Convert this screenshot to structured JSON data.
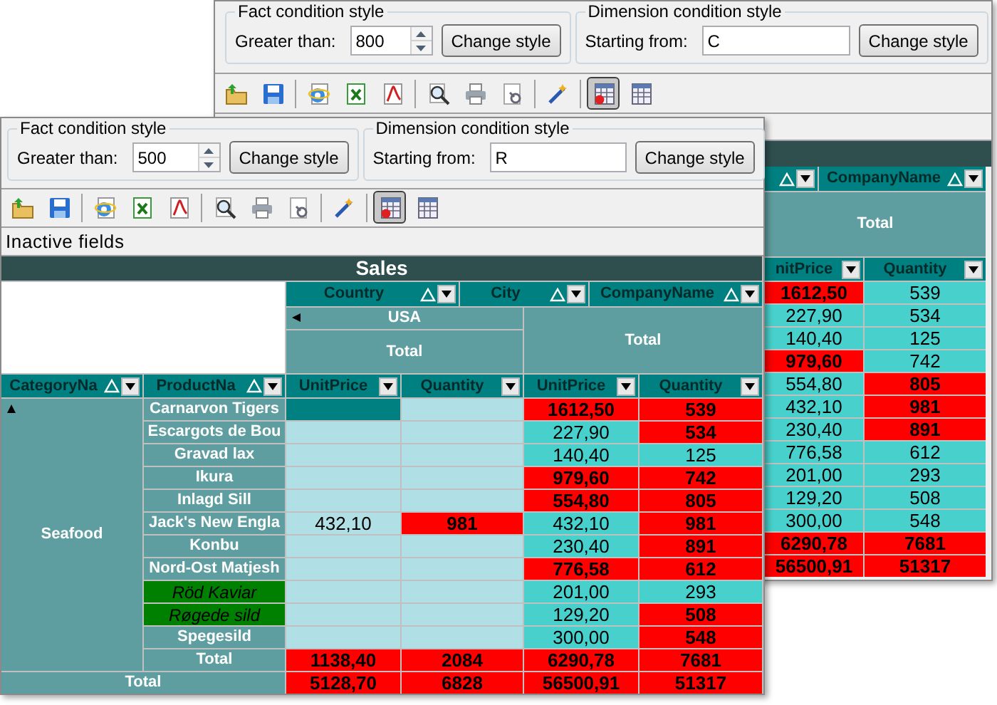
{
  "back_window": {
    "fact_condition": {
      "title": "Fact condition style",
      "label": "Greater than:",
      "value": "800",
      "button": "Change style"
    },
    "dimension_condition": {
      "title": "Dimension condition style",
      "label": "Starting from:",
      "value": "C",
      "button": "Change style"
    },
    "toolbar": [
      {
        "kind": "button",
        "pressed": false
      },
      {
        "kind": "button",
        "pressed": false
      },
      {
        "kind": "separator"
      },
      {
        "kind": "button",
        "pressed": false
      },
      {
        "kind": "button",
        "pressed": false
      },
      {
        "kind": "button",
        "pressed": false
      },
      {
        "kind": "separator"
      },
      {
        "kind": "button",
        "pressed": false
      },
      {
        "kind": "button",
        "pressed": false
      },
      {
        "kind": "button",
        "pressed": false
      },
      {
        "kind": "separator"
      },
      {
        "kind": "button",
        "pressed": false
      },
      {
        "kind": "separator"
      },
      {
        "kind": "button",
        "pressed": true
      },
      {
        "kind": "button",
        "pressed": false
      }
    ],
    "grid": {
      "column_fields": [
        {
          "sort_ascending": true
        },
        {
          "label": "CompanyName",
          "sort_ascending": true
        }
      ],
      "column_total": "Total",
      "measures": [
        {
          "label": "nitPrice"
        },
        {
          "label": "Quantity"
        }
      ],
      "rows": [
        {
          "cells": [
            {
              "value": "1612,50",
              "kind": "hot"
            },
            {
              "value": "539",
              "kind": "normal"
            }
          ]
        },
        {
          "cells": [
            {
              "value": "227,90",
              "kind": "normal"
            },
            {
              "value": "534",
              "kind": "normal"
            }
          ]
        },
        {
          "cells": [
            {
              "value": "140,40",
              "kind": "normal"
            },
            {
              "value": "125",
              "kind": "normal"
            }
          ]
        },
        {
          "cells": [
            {
              "value": "979,60",
              "kind": "hot"
            },
            {
              "value": "742",
              "kind": "normal"
            }
          ]
        },
        {
          "cells": [
            {
              "value": "554,80",
              "kind": "normal"
            },
            {
              "value": "805",
              "kind": "hot"
            }
          ]
        },
        {
          "cells": [
            {
              "value": "432,10",
              "kind": "normal"
            },
            {
              "value": "981",
              "kind": "hot"
            }
          ]
        },
        {
          "cells": [
            {
              "value": "230,40",
              "kind": "normal"
            },
            {
              "value": "891",
              "kind": "hot"
            }
          ]
        },
        {
          "cells": [
            {
              "value": "776,58",
              "kind": "normal"
            },
            {
              "value": "612",
              "kind": "normal"
            }
          ]
        },
        {
          "cells": [
            {
              "value": "201,00",
              "kind": "normal"
            },
            {
              "value": "293",
              "kind": "normal"
            }
          ]
        },
        {
          "cells": [
            {
              "value": "129,20",
              "kind": "normal"
            },
            {
              "value": "508",
              "kind": "normal"
            }
          ]
        },
        {
          "cells": [
            {
              "value": "300,00",
              "kind": "normal"
            },
            {
              "value": "548",
              "kind": "normal"
            }
          ]
        },
        {
          "cells": [
            {
              "value": "6290,78",
              "kind": "hot"
            },
            {
              "value": "7681",
              "kind": "hot"
            }
          ]
        },
        {
          "cells": [
            {
              "value": "56500,91",
              "kind": "hot"
            },
            {
              "value": "51317",
              "kind": "hot"
            }
          ]
        }
      ]
    }
  },
  "front_window": {
    "fact_condition": {
      "title": "Fact condition style",
      "label": "Greater than:",
      "value": "500",
      "button": "Change style"
    },
    "dimension_condition": {
      "title": "Dimension condition style",
      "label": "Starting from:",
      "value": "R",
      "button": "Change style"
    },
    "toolbar": [
      {
        "kind": "button",
        "pressed": false
      },
      {
        "kind": "button",
        "pressed": false
      },
      {
        "kind": "separator"
      },
      {
        "kind": "button",
        "pressed": false
      },
      {
        "kind": "button",
        "pressed": false
      },
      {
        "kind": "button",
        "pressed": false
      },
      {
        "kind": "separator"
      },
      {
        "kind": "button",
        "pressed": false
      },
      {
        "kind": "button",
        "pressed": false
      },
      {
        "kind": "button",
        "pressed": false
      },
      {
        "kind": "separator"
      },
      {
        "kind": "button",
        "pressed": false
      },
      {
        "kind": "separator"
      },
      {
        "kind": "button",
        "pressed": true
      },
      {
        "kind": "button",
        "pressed": false
      }
    ],
    "inactive_fields": "Inactive fields",
    "grid": {
      "title": "Sales",
      "column_fields": [
        {
          "label": "Country",
          "sort_ascending": true
        },
        {
          "label": "City",
          "sort_ascending": true
        },
        {
          "label": "CompanyName",
          "sort_ascending": true
        }
      ],
      "column_member": {
        "label": "USA",
        "expanded": true
      },
      "column_member_total": "Total",
      "column_total": "Total",
      "row_fields": [
        {
          "label": "CategoryNa",
          "sort_ascending": true
        },
        {
          "label": "ProductNa",
          "sort_ascending": true
        }
      ],
      "measures": [
        {
          "label": "UnitPrice"
        },
        {
          "label": "Quantity"
        },
        {
          "label": "UnitPrice"
        },
        {
          "label": "Quantity"
        }
      ],
      "category": {
        "label": "Seafood",
        "expanded": true
      },
      "rows": [
        {
          "label": "Carnarvon Tigers",
          "highlighted": false,
          "cells": [
            {
              "kind": "current"
            },
            {
              "kind": "empty"
            },
            {
              "value": "1612,50",
              "kind": "hot"
            },
            {
              "value": "539",
              "kind": "hot"
            }
          ]
        },
        {
          "label": "Escargots de Bou",
          "highlighted": false,
          "cells": [
            {
              "kind": "empty"
            },
            {
              "kind": "empty"
            },
            {
              "value": "227,90",
              "kind": "normal"
            },
            {
              "value": "534",
              "kind": "hot"
            }
          ]
        },
        {
          "label": "Gravad lax",
          "highlighted": false,
          "cells": [
            {
              "kind": "empty"
            },
            {
              "kind": "empty"
            },
            {
              "value": "140,40",
              "kind": "normal"
            },
            {
              "value": "125",
              "kind": "normal"
            }
          ]
        },
        {
          "label": "Ikura",
          "highlighted": false,
          "cells": [
            {
              "kind": "empty"
            },
            {
              "kind": "empty"
            },
            {
              "value": "979,60",
              "kind": "hot"
            },
            {
              "value": "742",
              "kind": "hot"
            }
          ]
        },
        {
          "label": "Inlagd Sill",
          "highlighted": false,
          "cells": [
            {
              "kind": "empty"
            },
            {
              "kind": "empty"
            },
            {
              "value": "554,80",
              "kind": "hot"
            },
            {
              "value": "805",
              "kind": "hot"
            }
          ]
        },
        {
          "label": "Jack's New Engla",
          "highlighted": false,
          "cells": [
            {
              "value": "432,10",
              "kind": "empty"
            },
            {
              "value": "981",
              "kind": "hot"
            },
            {
              "value": "432,10",
              "kind": "normal"
            },
            {
              "value": "981",
              "kind": "hot"
            }
          ]
        },
        {
          "label": "Konbu",
          "highlighted": false,
          "cells": [
            {
              "kind": "empty"
            },
            {
              "kind": "empty"
            },
            {
              "value": "230,40",
              "kind": "normal"
            },
            {
              "value": "891",
              "kind": "hot"
            }
          ]
        },
        {
          "label": "Nord-Ost Matjesh",
          "highlighted": false,
          "cells": [
            {
              "kind": "empty"
            },
            {
              "kind": "empty"
            },
            {
              "value": "776,58",
              "kind": "hot"
            },
            {
              "value": "612",
              "kind": "hot"
            }
          ]
        },
        {
          "label": "Röd Kaviar",
          "highlighted": true,
          "cells": [
            {
              "kind": "empty"
            },
            {
              "kind": "empty"
            },
            {
              "value": "201,00",
              "kind": "normal"
            },
            {
              "value": "293",
              "kind": "normal"
            }
          ]
        },
        {
          "label": "Røgede sild",
          "highlighted": true,
          "cells": [
            {
              "kind": "empty"
            },
            {
              "kind": "empty"
            },
            {
              "value": "129,20",
              "kind": "normal"
            },
            {
              "value": "508",
              "kind": "hot"
            }
          ]
        },
        {
          "label": "Spegesild",
          "highlighted": false,
          "cells": [
            {
              "kind": "empty"
            },
            {
              "kind": "empty"
            },
            {
              "value": "300,00",
              "kind": "normal"
            },
            {
              "value": "548",
              "kind": "hot"
            }
          ]
        },
        {
          "label": "Total",
          "highlighted": false,
          "cells": [
            {
              "value": "1138,40",
              "kind": "hot"
            },
            {
              "value": "2084",
              "kind": "hot"
            },
            {
              "value": "6290,78",
              "kind": "hot"
            },
            {
              "value": "7681",
              "kind": "hot"
            }
          ]
        }
      ],
      "grand_total": {
        "label": "Total",
        "cells": [
          {
            "value": "5128,70",
            "kind": "hot"
          },
          {
            "value": "6828",
            "kind": "hot"
          },
          {
            "value": "56500,91",
            "kind": "hot"
          },
          {
            "value": "51317",
            "kind": "hot"
          }
        ]
      }
    }
  }
}
